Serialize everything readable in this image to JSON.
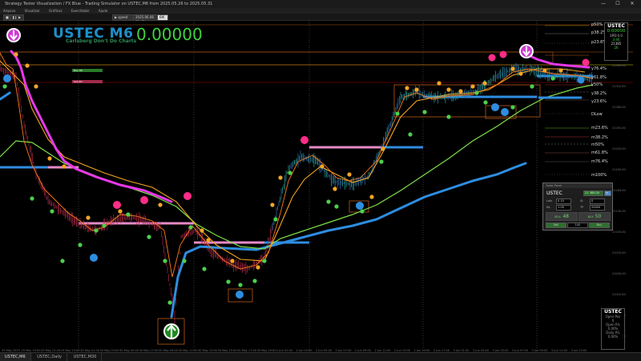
{
  "window": {
    "title": "Strategy Tester Visualization / FX Blue - Trading Simulator on USTEC,M6 from 2025.05.26 to 2025.05.31",
    "minimize": "—",
    "maximize": "☐",
    "close": "✕"
  },
  "menu": [
    "Arquivo",
    "Visualizar",
    "Gráficos",
    "Exercitador",
    "Ajuda"
  ],
  "toolbar": {
    "speed_label": "▶ speed",
    "date_value": "2025.06.06 03:45",
    "play_label": "6M"
  },
  "overlay": {
    "symbol_title": "USTEC M6",
    "subtitle": "Carlsberg Don't Do Charts",
    "price": "0.00000"
  },
  "levels": [
    {
      "label": "p50%"
    },
    {
      "label": "p38.2%"
    },
    {
      "label": "p23.6%"
    },
    {
      "label": "y76.4%"
    },
    {
      "label": "y61.8%"
    },
    {
      "label": "y50%"
    },
    {
      "label": "y38.2%"
    },
    {
      "label": "y23.6%"
    },
    {
      "label": "DLow"
    },
    {
      "label": "m23.6%"
    },
    {
      "label": "m38.2%"
    },
    {
      "label": "m50%"
    },
    {
      "label": "m61.8%"
    },
    {
      "label": "m76.4%"
    },
    {
      "label": "m100%"
    }
  ],
  "price_ticks": [
    "21370.00",
    "21340.00",
    "21310.00",
    "21280.00",
    "21250.00",
    "21220.00",
    "21190.00",
    "21160.00",
    "21130.00",
    "21100.00",
    "21070.00",
    "21040.00",
    "21010.00",
    "20980.00",
    "20950.00"
  ],
  "time_ticks": [
    "29 May 2025",
    "29 May 19:00",
    "29 May 21:00",
    "29 May 23:00",
    "30 May 01:00",
    "30 May 03:00",
    "30 May 05:00",
    "30 May 07:00",
    "30 May 09:00",
    "30 May 11:00",
    "30 May 13:00",
    "30 May 15:00",
    "30 May 17:00",
    "30 May 19:00",
    "2 Jun 01:00",
    "2 Jun 03:00",
    "2 Jun 05:00",
    "2 Jun 07:00",
    "2 Jun 09:00",
    "2 Jun 11:00",
    "2 Jun 13:00",
    "2 Jun 15:00",
    "2 Jun 17:00",
    "3 Jun 01:00",
    "3 Jun 03:00",
    "3 Jun 05:00",
    "3 Jun 07:00",
    "3 Jun 09:00",
    "3 Jun 11:00",
    "3 Jun 13:00"
  ],
  "info_box": {
    "symbol": "USTEC",
    "price": "0.00000",
    "spread": "SPD:0.0",
    "timer": "3:46",
    "last": "21385",
    "count": "26"
  },
  "mini_labels": {
    "buy": "Buy 4D",
    "sell": "Sell 4D"
  },
  "trade_panel": {
    "header": "Trade Panel",
    "symbol": "USTEC",
    "price_badge": "21 385.00",
    "lots_label": "Lots",
    "lots_value": "0.10",
    "sl_label": "SL",
    "sl_value": "0",
    "risk_label": "RA",
    "risk_value": "1.00",
    "tp_label": "TP",
    "tp_value": "20000",
    "sell_label": "SELL",
    "sell_price": "48",
    "buy_label": "BUY",
    "buy_price": "50",
    "sell_btn": "Sell",
    "close_btn": "100",
    "buy_btn": "Buy"
  },
  "stat_box": {
    "symbol": "USTEC",
    "open_pos_label": "Open Pos",
    "open_pos_value": "0",
    "open_pl_label": "Open P/L",
    "open_pl_value": "0.00%",
    "daily_label": "Daily P/L",
    "daily_value": "0.00%"
  },
  "tabs": [
    {
      "label": "USTEC,M6",
      "active": true
    },
    {
      "label": "USTEC,Daily",
      "active": false
    },
    {
      "label": "USTEC,M30",
      "active": false
    }
  ],
  "colors": {
    "ema_fast": "#ff8c1a",
    "ema_slow": "#7ee04a",
    "ma_long": "#2e8de0",
    "trend_pink": "#e838e8",
    "level_line": "#b8860b",
    "price_title": "#1e90c8",
    "price_value": "#3fd13f"
  }
}
